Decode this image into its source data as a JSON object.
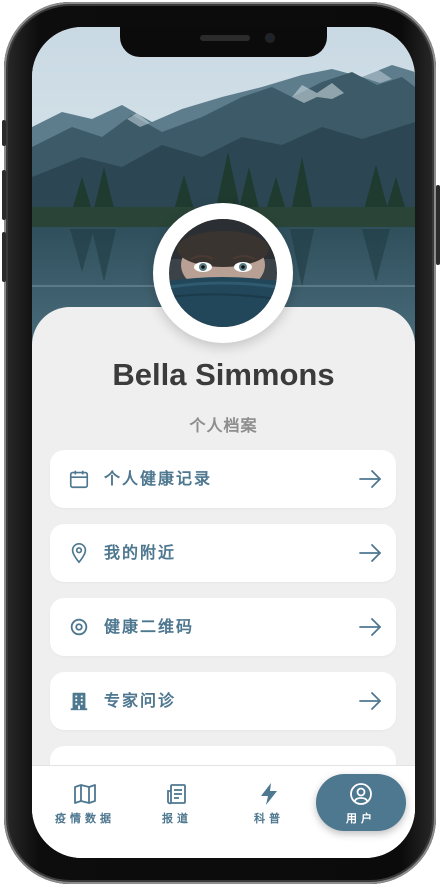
{
  "profile": {
    "name": "Bella Simmons",
    "subtitle": "个人档案"
  },
  "menu": [
    {
      "label": "个人健康记录",
      "icon": "calendar-icon"
    },
    {
      "label": "我的附近",
      "icon": "location-pin-icon"
    },
    {
      "label": "健康二维码",
      "icon": "target-icon"
    },
    {
      "label": "专家问诊",
      "icon": "building-icon"
    }
  ],
  "tabbar": {
    "items": [
      {
        "label": "疫情数据",
        "icon": "map-icon"
      },
      {
        "label": "报道",
        "icon": "news-icon"
      },
      {
        "label": "科普",
        "icon": "lightning-icon"
      },
      {
        "label": "用户",
        "icon": "user-icon",
        "active": true
      }
    ]
  },
  "colors": {
    "accent": "#4e7790",
    "name_text": "#3b3b3b",
    "subtitle_text": "#8d8d8d",
    "card_bg": "#efefef"
  }
}
